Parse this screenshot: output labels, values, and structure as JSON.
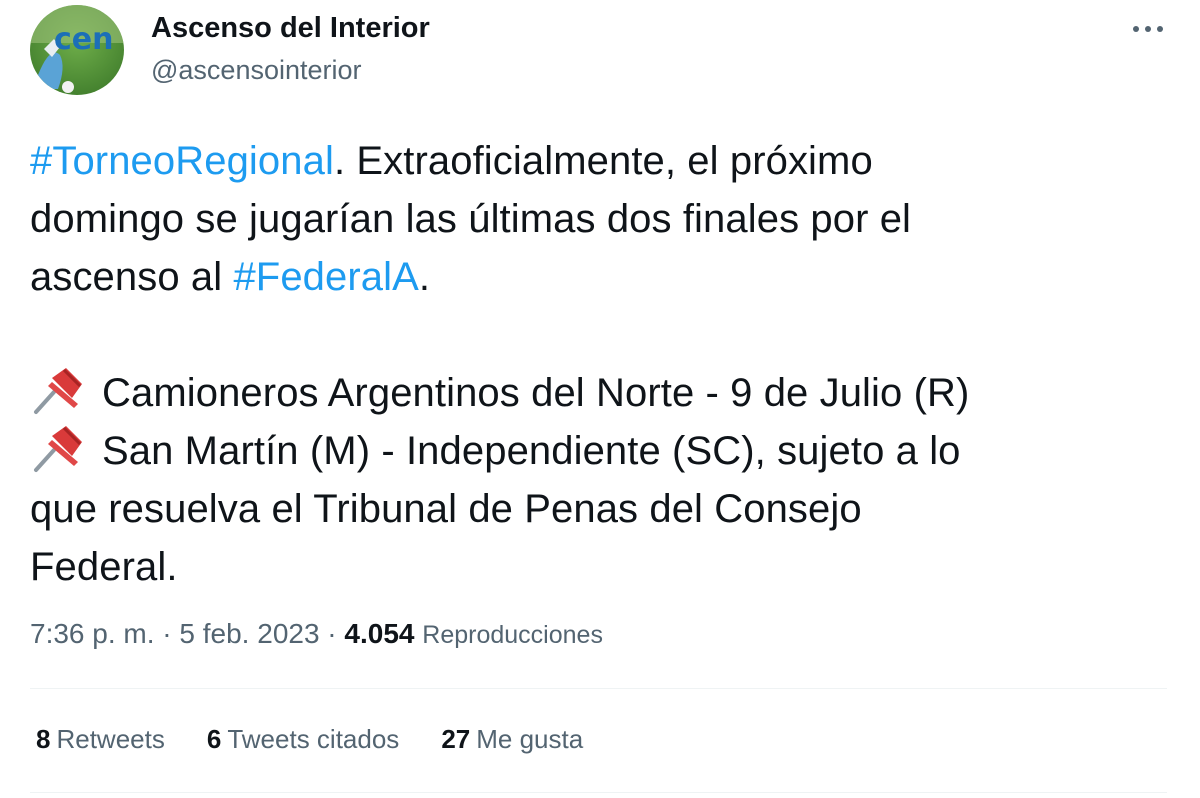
{
  "author": {
    "display_name": "Ascenso del Interior",
    "handle": "@ascensointerior",
    "avatar_text": "cen nter"
  },
  "tweet": {
    "hashtag_1": "#TorneoRegional",
    "text_1": ". Extraoficialmente, el próximo",
    "text_2": "domingo se jugarían las últimas dos finales por el",
    "text_3": "ascenso al ",
    "hashtag_2": "#FederalA",
    "text_4": ".",
    "match_1": "Camioneros Argentinos del Norte - 9 de Julio (R)",
    "match_2": "San Martín (M) - Independiente (SC), sujeto a lo",
    "text_5": "que resuelva el Tribunal de Penas del Consejo",
    "text_6": "Federal."
  },
  "meta": {
    "time": "7:36 p. m.",
    "separator": " · ",
    "date": "5 feb. 2023",
    "views_count": "4.054",
    "views_label": "Reproducciones"
  },
  "stats": {
    "retweets_count": "8",
    "retweets_label": "Retweets",
    "quotes_count": "6",
    "quotes_label": "Tweets citados",
    "likes_count": "27",
    "likes_label": "Me gusta"
  },
  "icons": {
    "more": "more-horizontal-icon",
    "pin": "pushpin-icon"
  },
  "colors": {
    "hashtag": "#1d9bf0",
    "secondary_text": "#536471",
    "primary_text": "#0f1419",
    "divider": "#eff3f4"
  }
}
